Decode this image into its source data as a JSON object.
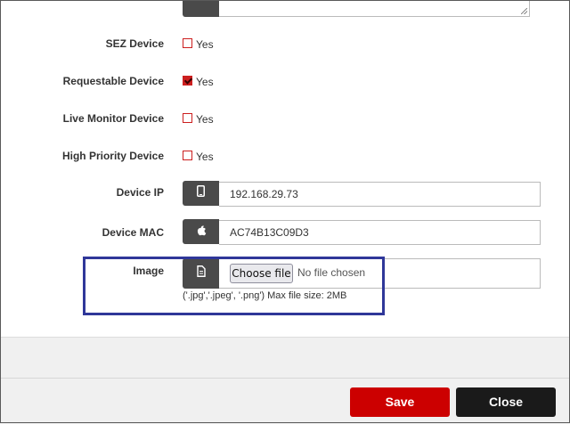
{
  "form": {
    "sez_device": {
      "label": "SEZ Device",
      "option": "Yes",
      "checked": false
    },
    "requestable_device": {
      "label": "Requestable Device",
      "option": "Yes",
      "checked": true
    },
    "live_monitor_device": {
      "label": "Live Monitor Device",
      "option": "Yes",
      "checked": false
    },
    "high_priority_device": {
      "label": "High Priority Device",
      "option": "Yes",
      "checked": false
    },
    "device_ip": {
      "label": "Device IP",
      "value": "192.168.29.73",
      "icon": "mobile-icon"
    },
    "device_mac": {
      "label": "Device MAC",
      "value": "AC74B13C09D3",
      "icon": "apple-icon"
    },
    "image": {
      "label": "Image",
      "icon": "file-icon",
      "choose_label": "Choose file",
      "status": "No file chosen",
      "hint": "('.jpg','.jpeg', '.png') Max file size: 2MB"
    }
  },
  "footer": {
    "save_label": "Save",
    "close_label": "Close"
  },
  "colors": {
    "accent": "#cc0000",
    "close": "#1a1a1a",
    "addon": "#4a4a4a",
    "highlight": "#2f3799"
  }
}
